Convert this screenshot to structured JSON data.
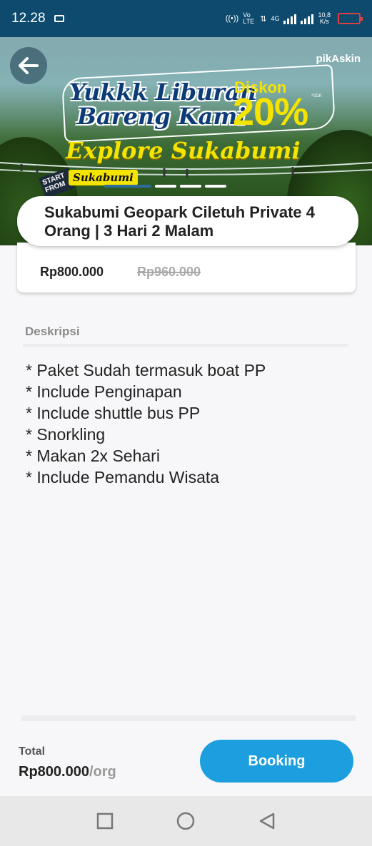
{
  "status_bar": {
    "time": "12.28",
    "volte": "Vo LTE",
    "network": "4G",
    "speed_value": "10,8",
    "speed_unit": "K/s"
  },
  "banner": {
    "brand": "pikAskin",
    "promo_line1": "Yukkk Liburan",
    "promo_line2": "Bareng Kami",
    "diskon_label": "Diskon",
    "diskon_value": "20%",
    "diskon_note": "*SDK",
    "explore": "Explore Sukabumi",
    "start_from": "START FROM",
    "start_city": "Sukabumi",
    "slides_count": 4,
    "active_slide": 1
  },
  "product": {
    "title": "Sukabumi Geopark Ciletuh Private 4 Orang | 3 Hari 2 Malam",
    "price": "Rp800.000",
    "original_price": "Rp960.000"
  },
  "description": {
    "heading": "Deskripsi",
    "items": [
      "* Paket Sudah termasuk boat PP",
      "* Include Penginapan",
      "* Include shuttle bus PP",
      "* Snorkling",
      "* Makan 2x Sehari",
      "* Include Pemandu Wisata"
    ]
  },
  "footer": {
    "total_label": "Total",
    "total_amount": "Rp800.000",
    "total_unit": "/org",
    "booking_label": "Booking"
  },
  "icons": {
    "back": "arrow-left-icon",
    "nav_recent": "square-icon",
    "nav_home": "circle-icon",
    "nav_back": "triangle-back-icon"
  },
  "colors": {
    "status_bar": "#0d4a6e",
    "accent": "#1d9fdf",
    "promo_yellow": "#f4e400",
    "promo_blue": "#0d3b78"
  }
}
